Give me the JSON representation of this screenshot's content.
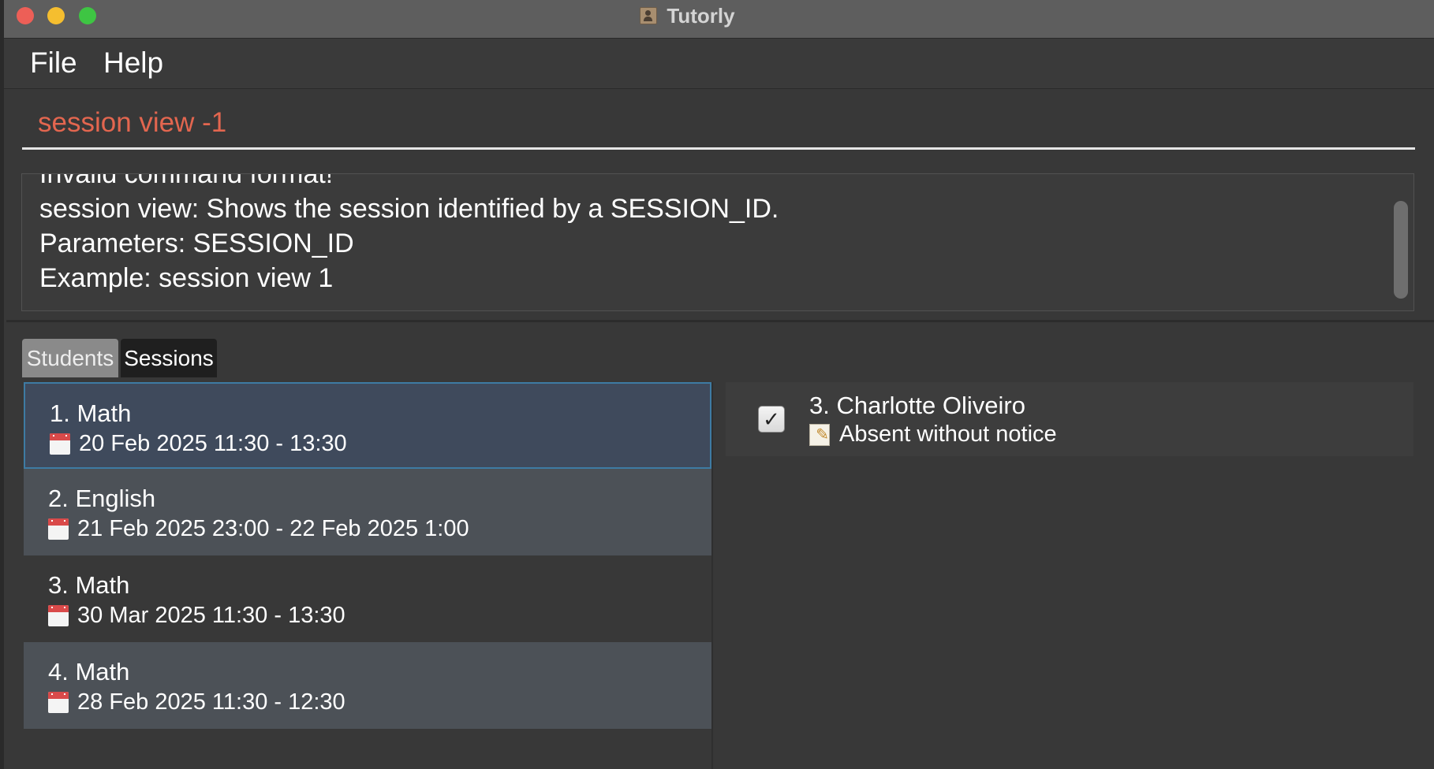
{
  "window": {
    "title": "Tutorly",
    "app_icon": "contact-card-icon"
  },
  "menu": {
    "file_label": "File",
    "help_label": "Help"
  },
  "command": {
    "value": "session view -1",
    "color": "#e3664f"
  },
  "result": {
    "text": "Invalid command format!\nsession view: Shows the session identified by a SESSION_ID.\nParameters: SESSION_ID\nExample: session view 1"
  },
  "tabs": [
    {
      "label": "Students",
      "selected": false
    },
    {
      "label": "Sessions",
      "selected": true
    }
  ],
  "sessions": [
    {
      "title": "1. Math",
      "time": "20 Feb 2025 11:30 - 13:30",
      "icon": "calendar-icon",
      "selected": true
    },
    {
      "title": "2. English",
      "time": "21 Feb 2025 23:00 - 22 Feb 2025 1:00",
      "icon": "calendar-icon",
      "selected": false
    },
    {
      "title": "3. Math",
      "time": "30 Mar 2025 11:30 - 13:30",
      "icon": "calendar-icon",
      "selected": false
    },
    {
      "title": "4. Math",
      "time": "28 Feb 2025 11:30 - 12:30",
      "icon": "calendar-icon",
      "selected": false
    }
  ],
  "attendance": {
    "student": "3. Charlotte Oliveiro",
    "note": "Absent without notice",
    "checked": true,
    "note_icon": "memo-icon"
  },
  "colors": {
    "accent_selection": "#3e7ba3",
    "close": "#ed5f57",
    "minimize": "#f5be2f",
    "maximize": "#3ec543"
  }
}
